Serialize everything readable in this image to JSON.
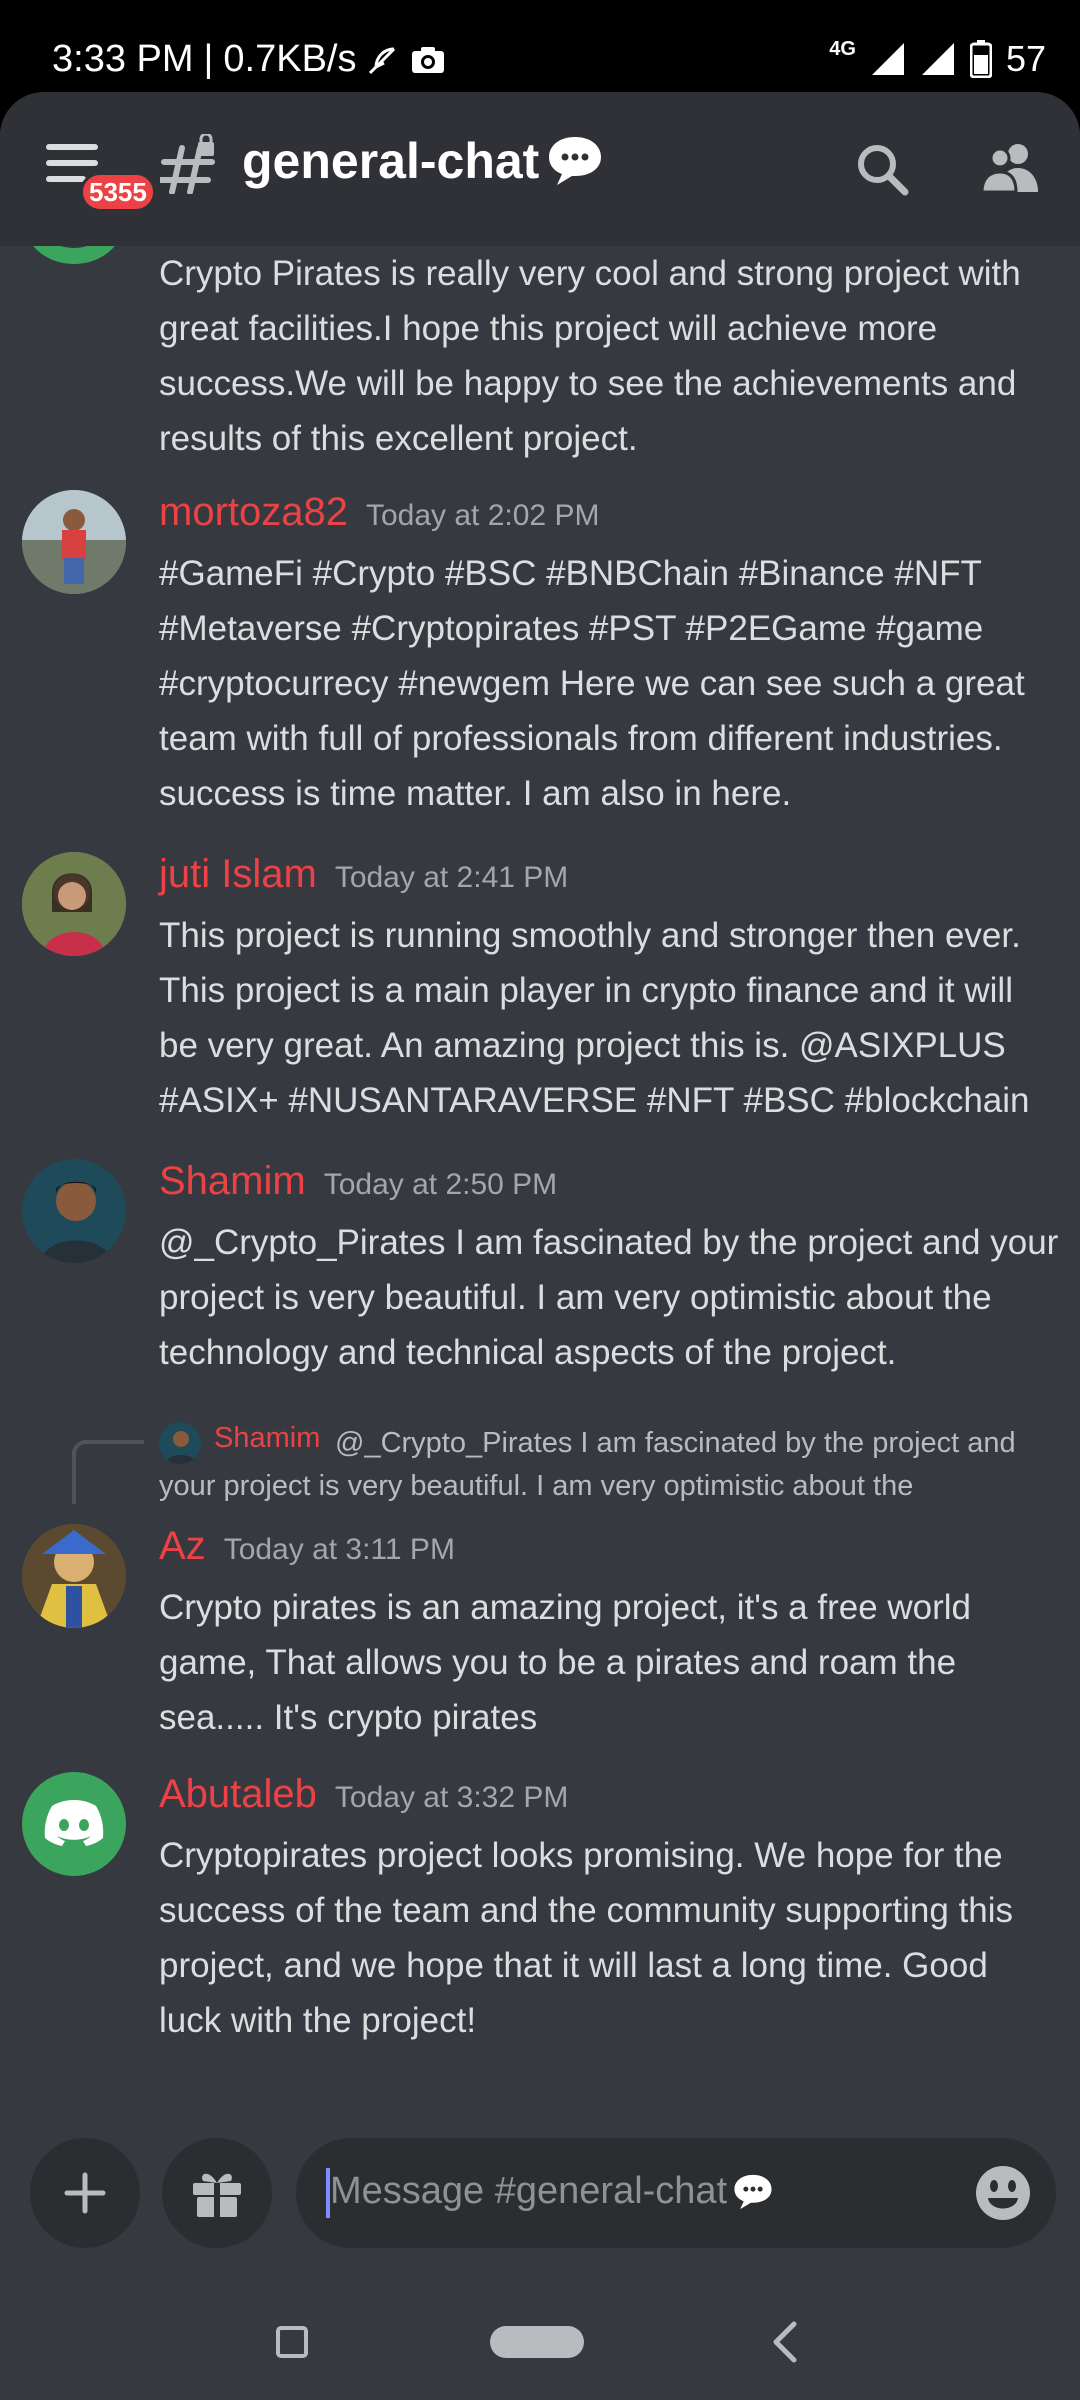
{
  "status_bar": {
    "time": "3:33 PM",
    "separator": "|",
    "speed": "0.7KB/s",
    "network": "4G",
    "battery": "57"
  },
  "header": {
    "notification_count": "5355",
    "channel_name": "general-chat"
  },
  "messages": [
    {
      "author": "",
      "time": "",
      "text": "Crypto Pirates is really very cool and strong project with great facilities.I hope this project will achieve more success.We will be happy to see the achievements and results of this excellent project."
    },
    {
      "author": "mortoza82",
      "time": "Today at 2:02 PM",
      "text": "#GameFi #Crypto #BSC #BNBChain #Binance   #NFT #Metaverse #Cryptopirates #PST #P2EGame #game #cryptocurrecy #newgem Here we can see such a great team with full of professionals from different industries. success is time matter. I am also in here."
    },
    {
      "author": "juti Islam",
      "time": "Today at 2:41 PM",
      "text": "This project is running smoothly and stronger then ever. This project is a main player in crypto finance and it will be very great. An amazing project this is. @ASIXPLUS #ASIX+ #NUSANTARAVERSE #NFT #BSC #blockchain"
    },
    {
      "author": "Shamim",
      "time": "Today at 2:50 PM",
      "text": "@_Crypto_Pirates I am fascinated by the project and your project is very beautiful. I am very optimistic about the technology and technical aspects of the project."
    },
    {
      "reply_to_author": "Shamim",
      "reply_text": "@_Crypto_Pirates I am fascinated by the project and your project is very beautiful. I am very optimistic about the",
      "author": "Az",
      "time": "Today at 3:11 PM",
      "text": "Crypto pirates is an amazing project, it's a free world game, That allows you to be a pirates and roam the sea..... It's crypto pirates"
    },
    {
      "author": "Abutaleb",
      "time": "Today at 3:32 PM",
      "text": "Cryptopirates  project looks promising. We hope for the success of the team and the community supporting this project, and we hope that it will last a long time. Good luck with the project!"
    }
  ],
  "composer": {
    "placeholder": "Message #general-chat"
  },
  "colors": {
    "background": "#36393f",
    "header": "#2f3136",
    "author_name": "#ed4245",
    "badge": "#ed4245",
    "discord_green": "#3ba55d"
  }
}
